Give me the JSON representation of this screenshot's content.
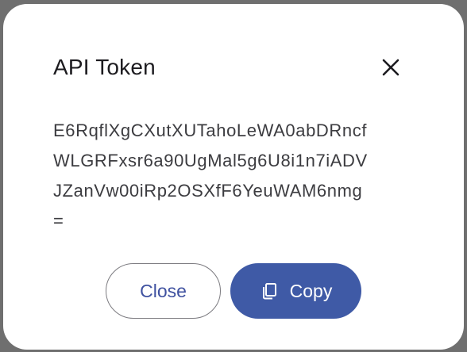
{
  "dialog": {
    "title": "API Token",
    "token_lines": [
      "E6RqflXgCXutXUTahoLeWA0abDRncf",
      "WLGRFxsr6a90UgMal5g6U8i1n7iADV",
      "JZanVw00iRp2OSXfF6YeuWAM6nmg",
      "="
    ],
    "close_label": "Close",
    "copy_label": "Copy"
  },
  "icons": {
    "close": "close-icon",
    "copy": "copy-icon"
  },
  "colors": {
    "primary": "#3f5aa6",
    "primary_text": "#3f51a0",
    "outline": "#7c7b80"
  }
}
